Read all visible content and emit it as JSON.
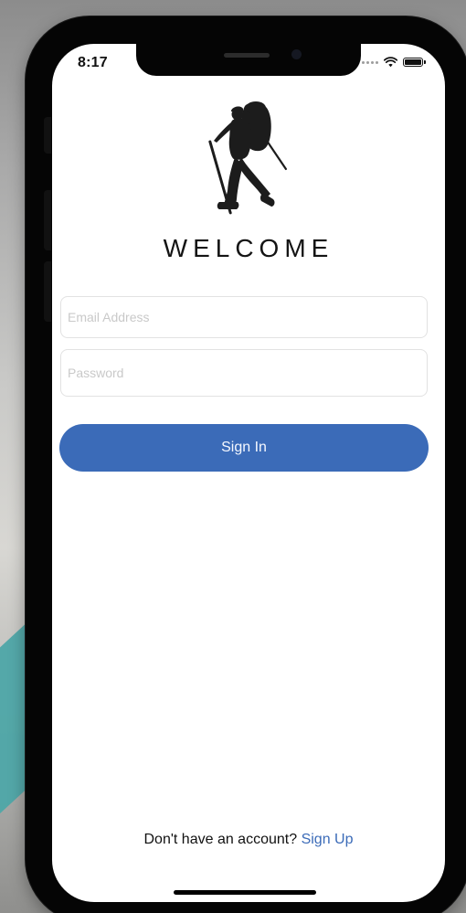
{
  "status_bar": {
    "time": "8:17",
    "wifi_icon": "wifi-icon",
    "battery_icon": "battery-icon",
    "signal_icon": "signal-icon"
  },
  "logo": {
    "icon": "hiker-icon"
  },
  "welcome": {
    "title": "WELCOME"
  },
  "form": {
    "email_placeholder": "Email Address",
    "email_value": "",
    "password_placeholder": "Password",
    "password_value": "",
    "signin_label": "Sign In"
  },
  "footer": {
    "prompt": "Don't have an account? ",
    "signup_label": "Sign Up"
  },
  "colors": {
    "primary": "#3b6bb8",
    "background": "#ffffff",
    "text": "#141414"
  }
}
